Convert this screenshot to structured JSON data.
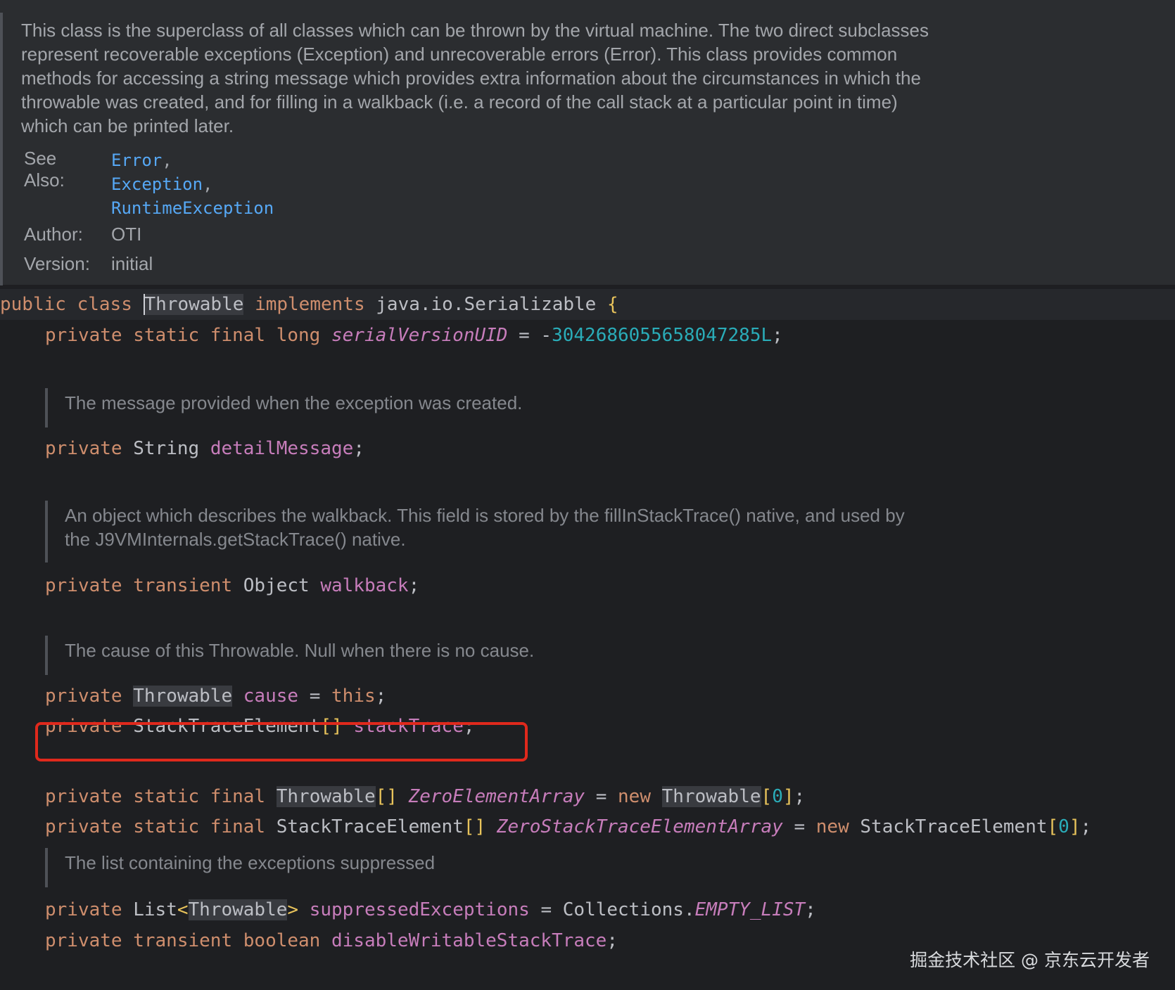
{
  "doc": {
    "description": "This class is the superclass of all classes which can be thrown by the virtual machine. The two direct subclasses represent recoverable exceptions (Exception) and unrecoverable errors (Error). This class provides common methods for accessing a string message which provides extra information about the circumstances in which the throwable was created, and for filling in a walkback (i.e. a record of the call stack at a particular point in time) which can be printed later.",
    "see_also_label": "See Also:",
    "see_also": [
      "Error",
      "Exception",
      "RuntimeException"
    ],
    "author_label": "Author:",
    "author": "OTI",
    "version_label": "Version:",
    "version": "initial"
  },
  "code": {
    "class_decl": {
      "public": "public",
      "class": "class",
      "name": "Throwable",
      "implements": "implements",
      "iface": "java.io.Serializable",
      "brace": "{"
    },
    "serial": {
      "mods": "private static final long",
      "name": "serialVersionUID",
      "eq": " = -",
      "value": "3042686055658047285L",
      "semi": ";"
    },
    "comment_message": "The message provided when the exception was created.",
    "detail": {
      "mod": "private",
      "type": "String",
      "name": "detailMessage",
      "semi": ";"
    },
    "comment_walkback": "An object which describes the walkback. This field is stored by the fillInStackTrace() native, and used by the J9VMInternals.getStackTrace() native.",
    "walkback": {
      "mods": "private transient",
      "type": "Object",
      "name": "walkback",
      "semi": ";"
    },
    "comment_cause": "The cause of this Throwable. Null when there is no cause.",
    "cause": {
      "mod": "private",
      "type": "Throwable",
      "name": "cause",
      "eq": " = ",
      "value": "this",
      "semi": ";"
    },
    "stack": {
      "mod": "private",
      "type": "StackTraceElement",
      "br": "[]",
      "name": "stackTrace",
      "semi": ";"
    },
    "zero_elem": {
      "mods": "private static final",
      "type": "Throwable",
      "br": "[]",
      "name": "ZeroElementArray",
      "eq": " = ",
      "new": "new",
      "type2": "Throwable",
      "open": "[",
      "num": "0",
      "close": "]",
      "semi": ";"
    },
    "zero_stack": {
      "mods": "private static final",
      "type": "StackTraceElement",
      "br": "[]",
      "name": "ZeroStackTraceElementArray",
      "eq": " = ",
      "new": "new",
      "type2": "StackTraceElement",
      "open": "[",
      "num": "0",
      "close": "]",
      "semi": ";"
    },
    "comment_suppressed": "The list containing the exceptions suppressed",
    "suppressed": {
      "mod": "private",
      "type": "List",
      "lt": "<",
      "generic": "Throwable",
      "gt": ">",
      "name": "suppressedExceptions",
      "eq": " = ",
      "cls": "Collections.",
      "constant": "EMPTY_LIST",
      "semi": ";"
    },
    "disable": {
      "mods": "private transient boolean",
      "name": "disableWritableStackTrace",
      "semi": ";"
    }
  },
  "watermark": "掘金技术社区 @ 京东云开发者",
  "colors": {
    "background": "#1e1f22",
    "keyword": "#cf8e6d",
    "field": "#c77dbb",
    "number": "#2aacb8",
    "link": "#56a8f5",
    "highlight_box": "#e0291c"
  }
}
